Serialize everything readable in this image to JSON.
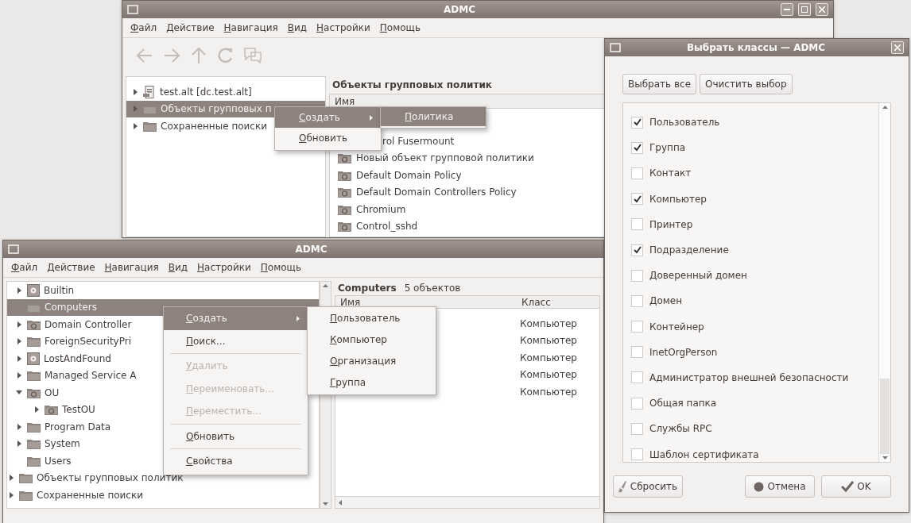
{
  "main_window": {
    "title": "ADMC",
    "menu": [
      "Файл",
      "Действие",
      "Навигация",
      "Вид",
      "Настройки",
      "Помощь"
    ],
    "toolbar": [
      {
        "kind": "back",
        "disabled": true
      },
      {
        "kind": "forward",
        "disabled": true
      },
      {
        "kind": "up",
        "disabled": true
      },
      {
        "kind": "refresh",
        "disabled": true
      },
      {
        "kind": "help",
        "disabled": true
      }
    ],
    "tree": [
      {
        "label": "test.alt [dc.test.alt]",
        "kind": "domain",
        "expanded": false,
        "selected": false
      },
      {
        "label": "Объекты групповых п",
        "kind": "folder",
        "expanded": false,
        "selected": true
      },
      {
        "label": "Сохраненные поиски",
        "kind": "folder",
        "expanded": false,
        "selected": false
      }
    ],
    "pane_title": "Объекты групповых политик",
    "columns": [
      "Имя"
    ],
    "rows": [
      {
        "label": "rol Fusermount"
      },
      {
        "label": "Новый объект групповой политики",
        "kind": "ou"
      },
      {
        "label": "Default Domain Policy",
        "kind": "ou"
      },
      {
        "label": "Default Domain Controllers Policy",
        "kind": "ou"
      },
      {
        "label": "Chromium",
        "kind": "ou"
      },
      {
        "label": "Control_sshd",
        "kind": "ou"
      }
    ],
    "context_menu": [
      {
        "label": "Создать",
        "selected": true,
        "submenu": true
      },
      {
        "label": "Обновить",
        "selected": false,
        "submenu": false
      }
    ],
    "submenu": [
      {
        "label": "Политика",
        "selected": true
      }
    ]
  },
  "second_window": {
    "title": "ADMC",
    "menu": [
      "Файл",
      "Действие",
      "Навигация",
      "Вид",
      "Настройки",
      "Помощь"
    ],
    "tree": [
      {
        "children": [
          {
            "label": "Builtin",
            "kind": "container",
            "expanded": false,
            "selected": false
          },
          {
            "label": "Computers",
            "kind": "folder",
            "selected": true
          },
          {
            "label": "Domain Controller",
            "kind": "ou",
            "expanded": false,
            "selected": false
          },
          {
            "label": "ForeignSecurityPri",
            "kind": "folder",
            "expanded": false,
            "selected": false
          },
          {
            "label": "LostAndFound",
            "kind": "container",
            "expanded": false,
            "selected": false
          },
          {
            "label": "Managed Service A",
            "kind": "folder",
            "expanded": false,
            "selected": false
          },
          {
            "label": "OU",
            "kind": "ou",
            "expanded": true,
            "selected": false,
            "children": [
              {
                "label": "TestOU",
                "kind": "ou",
                "expanded": false,
                "selected": false
              }
            ]
          },
          {
            "label": "Program Data",
            "kind": "folder",
            "expanded": false,
            "selected": false
          },
          {
            "label": "System",
            "kind": "folder",
            "expanded": false,
            "selected": false
          },
          {
            "label": "Users",
            "kind": "folder",
            "selected": false
          }
        ]
      },
      {
        "label": "Объекты групповых политик",
        "kind": "folder",
        "expanded": false,
        "selected": false
      },
      {
        "label": "Сохраненные поиски",
        "kind": "folder",
        "expanded": false,
        "selected": false
      }
    ],
    "pane_title": "Computers",
    "pane_count": "5 объектов",
    "columns": [
      "Имя",
      "Класс"
    ],
    "rows": [
      {
        "class": "Компьютер"
      },
      {
        "class": "Компьютер"
      },
      {
        "class": "Компьютер"
      },
      {
        "class": "Компьютер"
      },
      {
        "class": "Компьютер"
      }
    ],
    "context_menu": [
      {
        "kind": "item",
        "label": "Создать",
        "selected": true,
        "submenu": true,
        "disabled": false
      },
      {
        "kind": "item",
        "label": "Поиск...",
        "selected": false,
        "submenu": false,
        "disabled": false
      },
      {
        "kind": "separator"
      },
      {
        "kind": "item",
        "label": "Удалить",
        "selected": false,
        "submenu": false,
        "disabled": true
      },
      {
        "kind": "item",
        "label": "Переименовать...",
        "selected": false,
        "submenu": false,
        "disabled": true
      },
      {
        "kind": "item",
        "label": "Переместить...",
        "selected": false,
        "submenu": false,
        "disabled": true
      },
      {
        "kind": "separator"
      },
      {
        "kind": "item",
        "label": "Обновить",
        "selected": false,
        "submenu": false,
        "disabled": false
      },
      {
        "kind": "separator"
      },
      {
        "kind": "item",
        "label": "Свойства",
        "selected": false,
        "submenu": false,
        "disabled": false
      }
    ],
    "submenu": [
      {
        "label": "Пользователь",
        "selected": false
      },
      {
        "label": "Компьютер",
        "selected": false
      },
      {
        "label": "Организация",
        "selected": false
      },
      {
        "label": "Группа",
        "selected": false
      }
    ]
  },
  "dialog": {
    "title": "Выбрать классы — ADMC",
    "top_buttons": [
      "Выбрать все",
      "Очистить выбор"
    ],
    "classes": [
      {
        "label": "Пользователь",
        "checked": true
      },
      {
        "label": "Группа",
        "checked": true
      },
      {
        "label": "Контакт",
        "checked": false
      },
      {
        "label": "Компьютер",
        "checked": true
      },
      {
        "label": "Принтер",
        "checked": false
      },
      {
        "label": "Подразделение",
        "checked": true
      },
      {
        "label": "Доверенный домен",
        "checked": false
      },
      {
        "label": "Домен",
        "checked": false
      },
      {
        "label": "Контейнер",
        "checked": false
      },
      {
        "label": "InetOrgPerson",
        "checked": false
      },
      {
        "label": "Администратор внешней безопасности",
        "checked": false
      },
      {
        "label": "Общая папка",
        "checked": false
      },
      {
        "label": "Службы RPC",
        "checked": false
      },
      {
        "label": "Шаблон сертификата",
        "checked": false
      }
    ],
    "buttons": [
      {
        "kind": "reset",
        "label": "Сбросить"
      },
      {
        "kind": "cancel",
        "label": "Отмена"
      },
      {
        "kind": "ok",
        "label": "OK"
      }
    ]
  }
}
